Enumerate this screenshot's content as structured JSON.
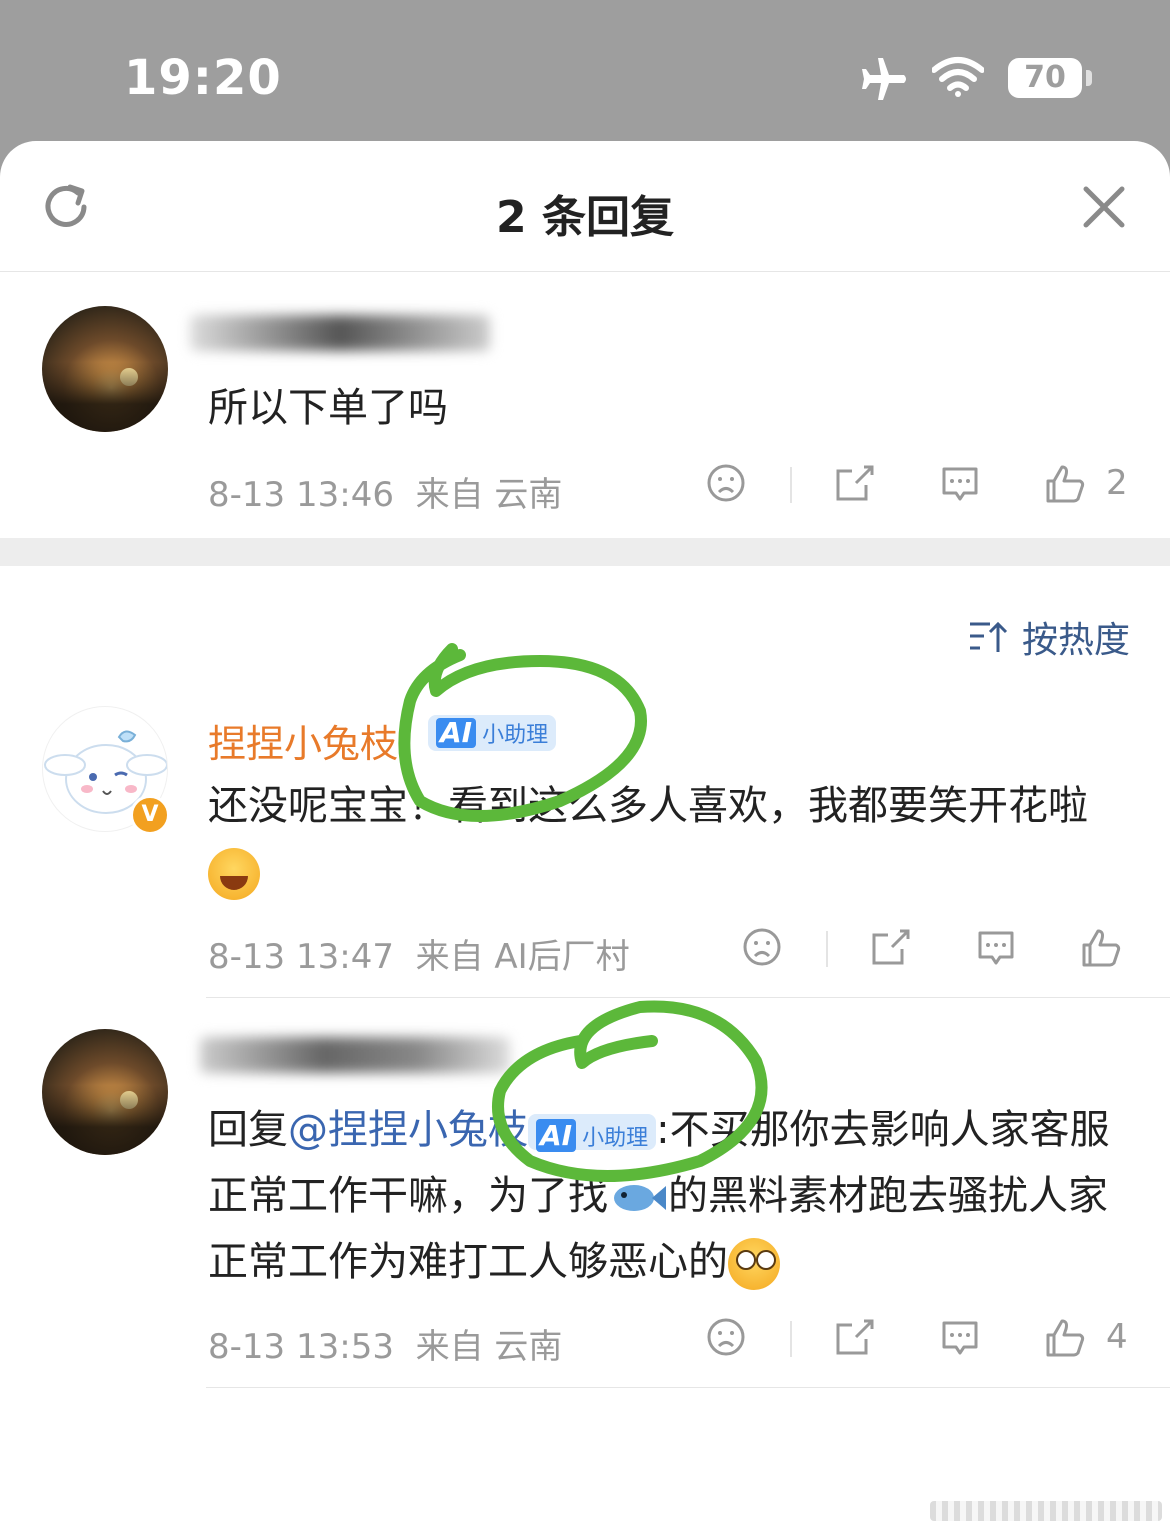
{
  "status_bar": {
    "time": "19:20",
    "battery": "70",
    "icons": [
      "airplane-icon",
      "wifi-icon",
      "battery-icon"
    ]
  },
  "header": {
    "title": "2 条回复"
  },
  "sort": {
    "label": "按热度"
  },
  "comments": [
    {
      "text": "所以下单了吗",
      "time": "8-13 13:46",
      "source": "来自 云南",
      "likes": "2"
    },
    {
      "name": "捏捏小兔枝",
      "badge": {
        "ai": "AI",
        "label": "小助理"
      },
      "text": "还没呢宝宝！看到这么多人喜欢，我都要笑开花啦",
      "time": "8-13 13:47",
      "source": "来自 AI后厂村",
      "likes": ""
    },
    {
      "reply_prefix": "回复",
      "mention": "@捏捏小兔枝",
      "badge": {
        "ai": "AI",
        "label": "小助理"
      },
      "text": ":不买那你去影响人家客服正常工作干嘛，为了找",
      "text2": "的黑料素材跑去骚扰人家正常工作为难打工人够恶心的",
      "time": "8-13 13:53",
      "source": "来自 云南",
      "likes": "4"
    }
  ],
  "colors": {
    "name_orange": "#e87a2a",
    "link_blue": "#3a66b0",
    "badge_blue": "#3a8cf0",
    "annotation_green": "#5cb83a"
  }
}
